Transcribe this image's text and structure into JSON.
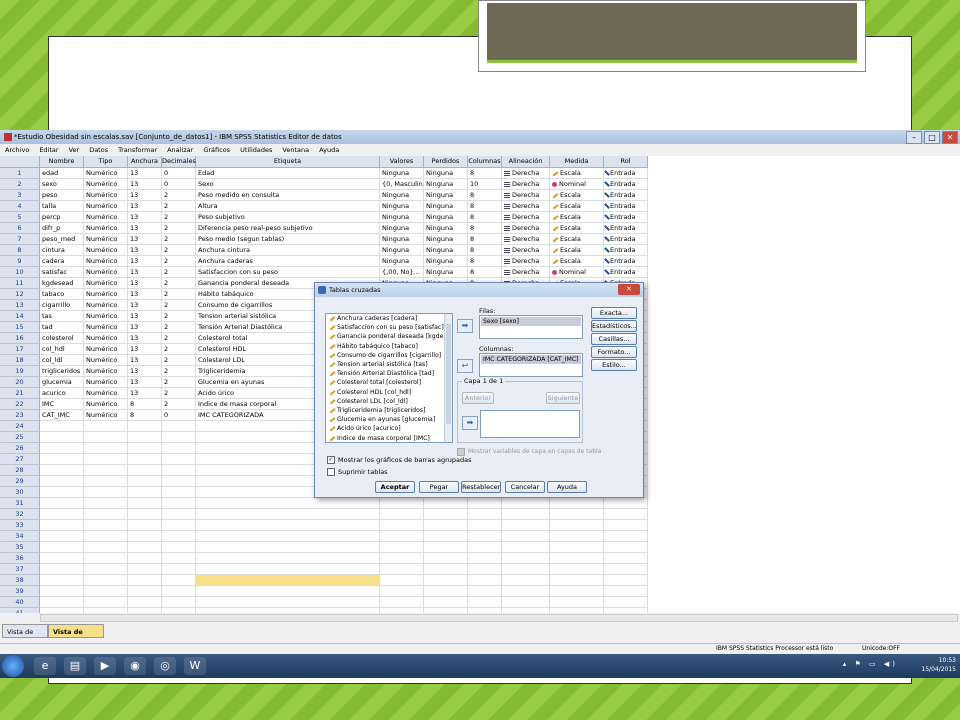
{
  "window": {
    "title": "*Estudio Obesidad sin escalas.sav [Conjunto_de_datos1] - IBM SPSS Statistics Editor de datos",
    "minimize": "–",
    "maximize": "□",
    "close": "✕"
  },
  "menu": [
    "Archivo",
    "Editar",
    "Ver",
    "Datos",
    "Transformar",
    "Analizar",
    "Gráficos",
    "Utilidades",
    "Ventana",
    "Ayuda"
  ],
  "columns": [
    "Nombre",
    "Tipo",
    "Anchura",
    "Decimales",
    "Etiqueta",
    "Valores",
    "Perdidos",
    "Columnas",
    "Alineación",
    "Medida",
    "Rol"
  ],
  "rows": [
    [
      "edad",
      "Numérico",
      "13",
      "0",
      "Edad",
      "Ninguna",
      "Ninguna",
      "8",
      "Derecha",
      "Escala",
      "Entrada"
    ],
    [
      "sexo",
      "Numérico",
      "13",
      "0",
      "Sexo",
      "{0, Masculin...",
      "Ninguna",
      "10",
      "Derecha",
      "Nominal",
      "Entrada"
    ],
    [
      "peso",
      "Numérico",
      "13",
      "2",
      "Peso medido en consulta",
      "Ninguna",
      "Ninguna",
      "8",
      "Derecha",
      "Escala",
      "Entrada"
    ],
    [
      "talla",
      "Numérico",
      "13",
      "2",
      "Altura",
      "Ninguna",
      "Ninguna",
      "8",
      "Derecha",
      "Escala",
      "Entrada"
    ],
    [
      "percp",
      "Numérico",
      "13",
      "2",
      "Peso subjetivo",
      "Ninguna",
      "Ninguna",
      "8",
      "Derecha",
      "Escala",
      "Entrada"
    ],
    [
      "difr_p",
      "Numérico",
      "13",
      "2",
      "Diferencia peso real-peso subjetivo",
      "Ninguna",
      "Ninguna",
      "8",
      "Derecha",
      "Escala",
      "Entrada"
    ],
    [
      "peso_med",
      "Numérico",
      "13",
      "2",
      "Peso medio (segun tablas)",
      "Ninguna",
      "Ninguna",
      "8",
      "Derecha",
      "Escala",
      "Entrada"
    ],
    [
      "cintura",
      "Numérico",
      "13",
      "2",
      "Anchura cintura",
      "Ninguna",
      "Ninguna",
      "8",
      "Derecha",
      "Escala",
      "Entrada"
    ],
    [
      "cadera",
      "Numérico",
      "13",
      "2",
      "Anchura caderas",
      "Ninguna",
      "Ninguna",
      "8",
      "Derecha",
      "Escala",
      "Entrada"
    ],
    [
      "satisfac",
      "Numérico",
      "13",
      "2",
      "Satisfaccion con su peso",
      "{,00, No}...",
      "Ninguna",
      "8",
      "Derecha",
      "Nominal",
      "Entrada"
    ],
    [
      "kgdesead",
      "Numérico",
      "13",
      "2",
      "Ganancia ponderal deseada",
      "Ninguna",
      "Ninguna",
      "8",
      "Derecha",
      "Escala",
      "Entrada"
    ],
    [
      "tabaco",
      "Numérico",
      "13",
      "2",
      "Hábito tabáquico",
      "",
      "",
      "",
      "",
      "",
      ""
    ],
    [
      "cigarrillo",
      "Numérico",
      "13",
      "2",
      "Consumo de cigarrillos",
      "",
      "",
      "",
      "",
      "",
      ""
    ],
    [
      "tas",
      "Numérico",
      "13",
      "2",
      "Tension arterial sistólica",
      "",
      "",
      "",
      "",
      "",
      ""
    ],
    [
      "tad",
      "Numérico",
      "13",
      "2",
      "Tensión Arterial Diastólica",
      "",
      "",
      "",
      "",
      "",
      ""
    ],
    [
      "colesterol",
      "Numérico",
      "13",
      "2",
      "Colesterol total",
      "",
      "",
      "",
      "",
      "",
      ""
    ],
    [
      "col_hdl",
      "Numérico",
      "13",
      "2",
      "Colesterol HDL",
      "",
      "",
      "",
      "",
      "",
      ""
    ],
    [
      "col_ldl",
      "Numérico",
      "13",
      "2",
      "Colesterol LDL",
      "",
      "",
      "",
      "",
      "",
      ""
    ],
    [
      "trigliceridos",
      "Numérico",
      "13",
      "2",
      "Trigliceridemia",
      "",
      "",
      "",
      "",
      "",
      ""
    ],
    [
      "glucemia",
      "Numérico",
      "13",
      "2",
      "Glucemia en ayunas",
      "",
      "",
      "",
      "",
      "",
      ""
    ],
    [
      "acurico",
      "Numérico",
      "13",
      "2",
      "Acido úrico",
      "",
      "",
      "",
      "",
      "",
      ""
    ],
    [
      "IMC",
      "Numérico",
      "8",
      "2",
      "Indice de masa corporal",
      "",
      "",
      "",
      "",
      "",
      ""
    ],
    [
      "CAT_IMC",
      "Numérico",
      "8",
      "0",
      "IMC CATEGORIZADA",
      "",
      "",
      "",
      "",
      "",
      ""
    ]
  ],
  "total_rows": 41,
  "highlight_row": 38,
  "tabs": {
    "data": "Vista de datos",
    "variables": "Vista de variables"
  },
  "status": {
    "processor": "IBM SPSS Statistics Processor está listo",
    "unicode": "Unicode:OFF"
  },
  "taskbar": {
    "time": "10:53",
    "date": "15/04/2015"
  },
  "dialog": {
    "title": "Tablas cruzadas",
    "close": "✕",
    "variables": [
      "Anchura caderas [cadera]",
      "Satisfaccion con su peso [satisfac]",
      "Ganancia ponderal deseada [kgde...",
      "Hábito tabáquico [tabaco]",
      "Consumo de cigarrillos [cigarrillo]",
      "Tension arterial sistólica [tas]",
      "Tensión Arterial Diastólica [tad]",
      "Colesterol total [colesterol]",
      "Colesterol HDL [col_hdl]",
      "Colesterol LDL [col_ldl]",
      "Trigliceridemia [trigliceridos]",
      "Glucemia en ayunas [glucemia]",
      "Acido úrico [acurico]",
      "Indice de masa corporal [IMC]"
    ],
    "rows_label": "Filas:",
    "rows_value": "Sexo [sexo]",
    "cols_label": "Columnas:",
    "cols_value": "IMC CATEGORIZADA [CAT_IMC]",
    "layer_label": "Capa 1 de 1",
    "prev": "Anterior",
    "next": "Siguiente",
    "show_layers": "Mostrar variables de capa en capas de tabla",
    "clustered": "Mostrar los gráficos de barras agrupadas",
    "suppress": "Suprimir tablas",
    "side_buttons": [
      "Exacta...",
      "Estadísticos...",
      "Casillas...",
      "Formato...",
      "Estilo..."
    ],
    "bottom_buttons": [
      "Aceptar",
      "Pegar",
      "Restablecer",
      "Cancelar",
      "Ayuda"
    ]
  }
}
